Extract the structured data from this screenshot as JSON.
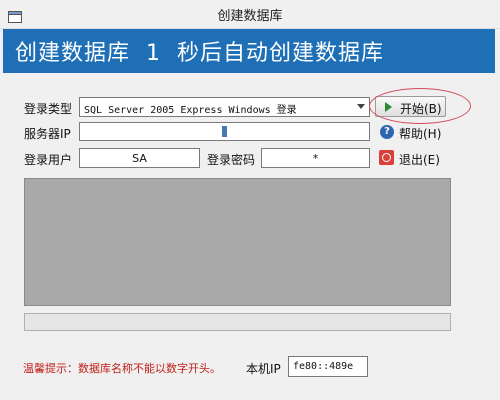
{
  "window": {
    "title": "创建数据库"
  },
  "banner": {
    "text": "创建数据库  1  秒后自动创建数据库"
  },
  "form": {
    "db_type_label": "登录类型",
    "db_type_value": "SQL Server 2005 Express Windows 登录",
    "server_ip_label": "服务器IP",
    "server_ip_value": "",
    "user_label": "登录用户",
    "user_value": "SA",
    "password_label": "登录密码",
    "password_value": "*"
  },
  "buttons": {
    "start": "开始(B)",
    "help": "帮助(H)",
    "exit": "退出(E)"
  },
  "footer": {
    "tip": "温馨提示：数据库名称不能以数字开头。",
    "local_ip_label": "本机IP",
    "local_ip_value": "fe80::489e"
  },
  "icons": {
    "start": "play-icon",
    "help": "help-icon",
    "exit": "power-icon"
  },
  "colors": {
    "banner": "#1f6fb6",
    "tip": "#c0201a",
    "highlight": "#d4485a"
  }
}
